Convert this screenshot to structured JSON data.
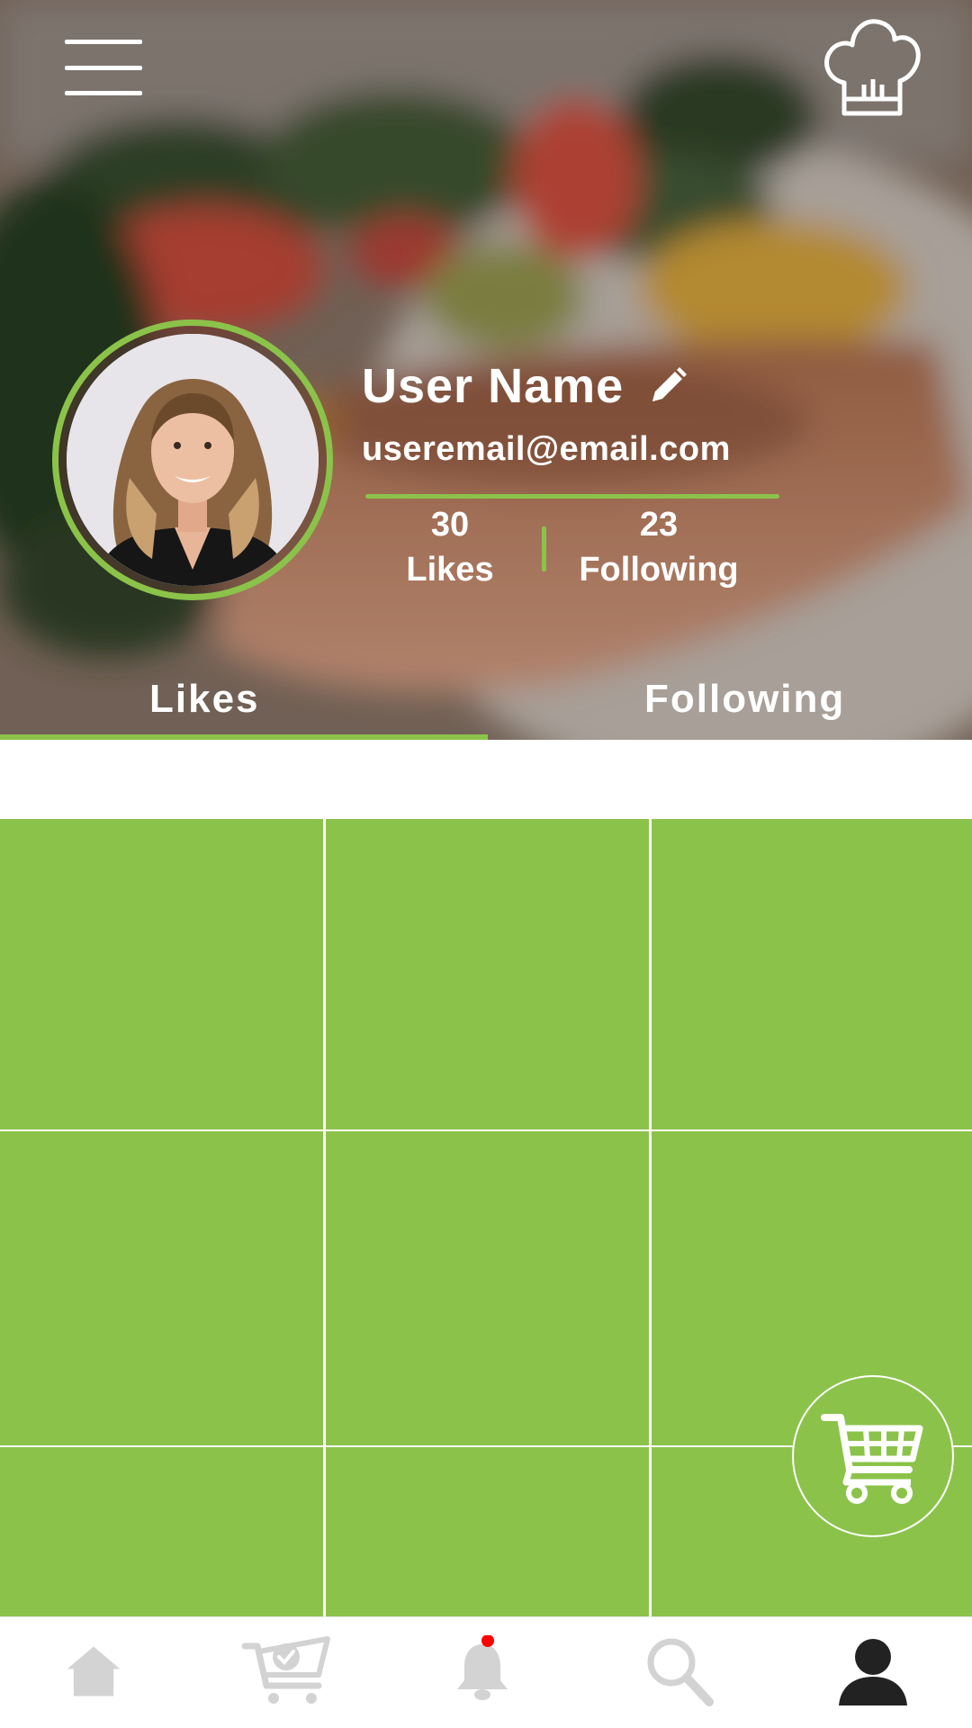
{
  "header": {
    "menu_icon": "hamburger-menu-icon",
    "chef_icon": "chef-hat-icon"
  },
  "profile": {
    "name": "User Name",
    "email": "useremail@email.com",
    "edit_icon": "pencil-icon",
    "stats": {
      "likes_count": "30",
      "likes_label": "Likes",
      "following_count": "23",
      "following_label": "Following"
    }
  },
  "tabs": [
    {
      "label": "Likes",
      "active": true
    },
    {
      "label": "Following",
      "active": false
    }
  ],
  "grid": {
    "tile_count": 9,
    "tile_color": "#8bc34a"
  },
  "fab": {
    "icon": "shopping-cart-icon"
  },
  "bottom_nav": [
    {
      "icon": "home-icon",
      "active": false
    },
    {
      "icon": "cart-check-icon",
      "active": false
    },
    {
      "icon": "bell-icon",
      "active": false,
      "notification_dot": true
    },
    {
      "icon": "search-icon",
      "active": false
    },
    {
      "icon": "user-profile-icon",
      "active": true
    }
  ],
  "colors": {
    "accent": "#8bc34a",
    "nav_inactive": "#d3d3d3",
    "nav_active": "#222222",
    "notification": "#ff0000"
  }
}
